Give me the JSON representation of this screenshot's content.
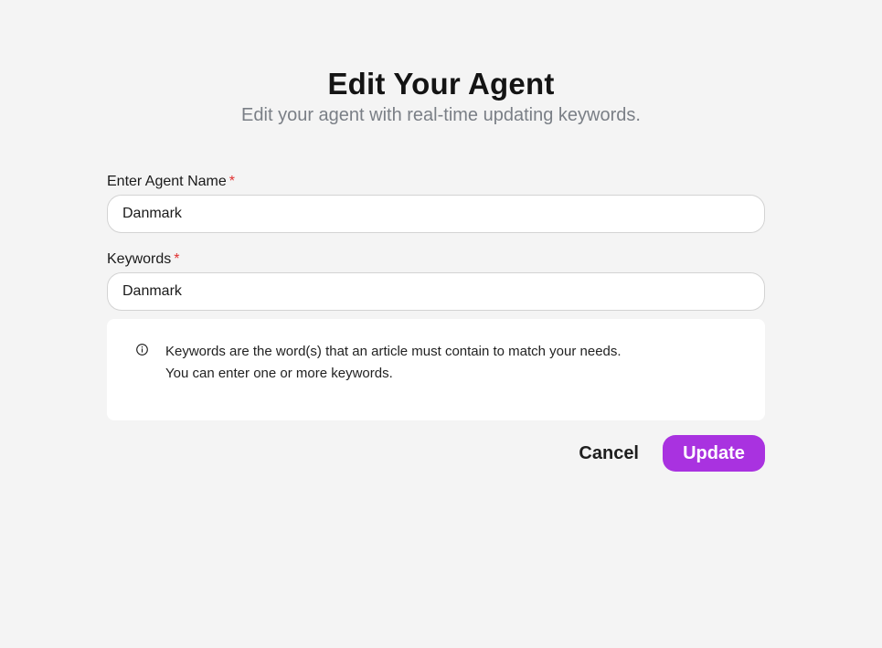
{
  "header": {
    "title": "Edit Your Agent",
    "subtitle": "Edit your agent with real-time updating keywords."
  },
  "form": {
    "agent_name": {
      "label": "Enter Agent Name",
      "required_marker": "*",
      "value": "Danmark"
    },
    "keywords": {
      "label": "Keywords",
      "required_marker": "*",
      "value": "Danmark"
    },
    "info": {
      "icon": "info-circle-icon",
      "line1": "Keywords are the word(s) that an article must contain to match your needs.",
      "line2": "You can enter one or more keywords."
    }
  },
  "actions": {
    "cancel_label": "Cancel",
    "update_label": "Update"
  },
  "colors": {
    "background": "#f4f4f4",
    "accent": "#a932e0",
    "required": "#e03131",
    "subtitle": "#7a7f86"
  }
}
